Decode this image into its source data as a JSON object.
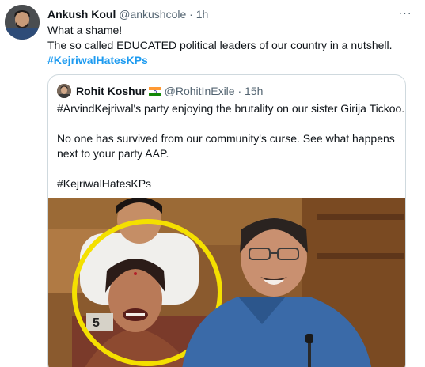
{
  "tweet": {
    "author_name": "Ankush Koul",
    "author_handle": "@ankushcole",
    "separator": "·",
    "time": "1h",
    "lines": [
      "What a shame!",
      "The so called EDUCATED political leaders of our country in a nutshell."
    ],
    "hashtag": "#KejriwalHatesKPs",
    "more_label": "···"
  },
  "quoted": {
    "author_name": "Rohit Koshur",
    "author_handle": "@RohitInExile",
    "separator": "·",
    "time": "15h",
    "line1": "#ArvindKejriwal's party enjoying the brutality on our sister Girija Tickoo.",
    "line2": "No one has survived from our community's curse. See what happens",
    "line3": "next to your party AAP.",
    "line4": "#KejriwalHatesKPs",
    "photo_placard": "5"
  },
  "colors": {
    "link": "#1d9bf0",
    "secondary_text": "#536471",
    "border": "#cfd9de",
    "highlight_circle": "#f4e000"
  },
  "icons": {
    "more": "more-horizontal-icon",
    "flag": "india-flag-icon"
  }
}
